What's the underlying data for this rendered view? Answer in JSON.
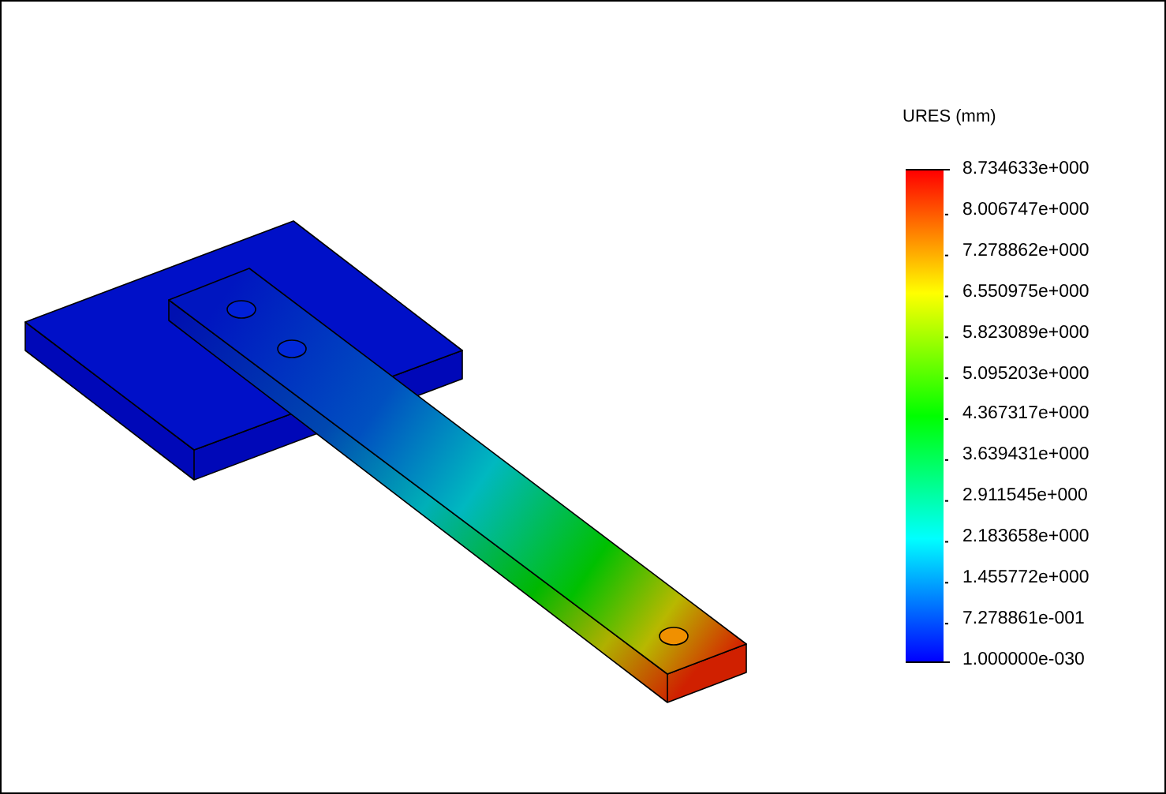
{
  "legend": {
    "title": "URES (mm)",
    "labels": [
      "8.734633e+000",
      "8.006747e+000",
      "7.278862e+000",
      "6.550975e+000",
      "5.823089e+000",
      "5.095203e+000",
      "4.367317e+000",
      "3.639431e+000",
      "2.911545e+000",
      "2.183658e+000",
      "1.455772e+000",
      "7.278861e-001",
      "1.000000e-030"
    ]
  }
}
